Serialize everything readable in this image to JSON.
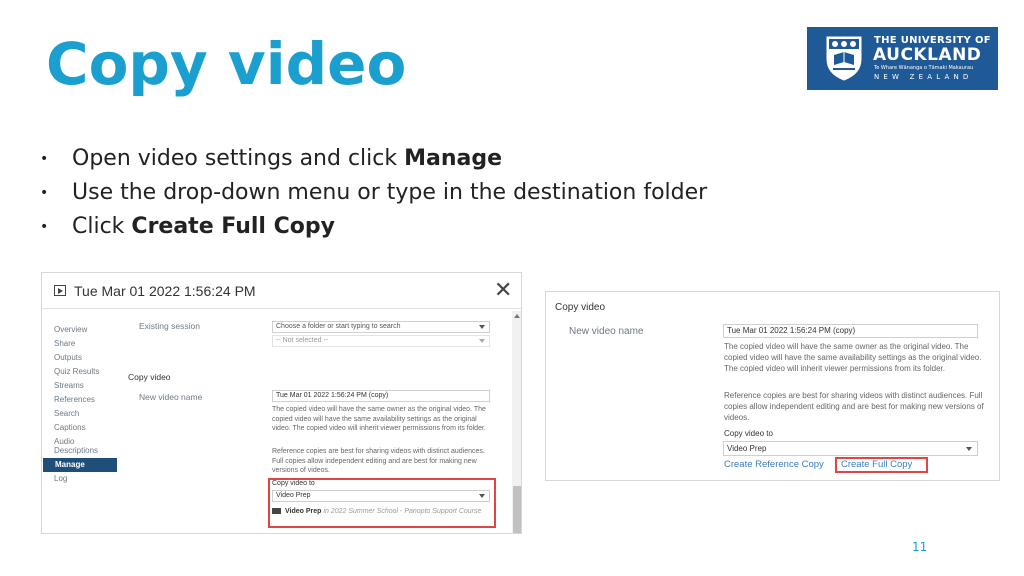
{
  "slide": {
    "title": "Copy video",
    "page_number": "11",
    "accent_color": "#1a9fcf"
  },
  "logo": {
    "line1": "THE UNIVERSITY OF",
    "line2": "AUCKLAND",
    "line3": "Te Whare Wānanga o Tāmaki Makaurau",
    "line4": "NEW ZEALAND",
    "bg_color": "#1f5a96"
  },
  "bullets": [
    {
      "text": "Open video settings and click ",
      "bold": "Manage"
    },
    {
      "text": "Use the drop-down menu or type in the destination folder",
      "bold": ""
    },
    {
      "text": "Click ",
      "bold": "Create Full Copy"
    }
  ],
  "bullet_glyph": "•",
  "settings_dialog": {
    "title": "Tue Mar 01 2022 1:56:24 PM",
    "close_glyph": "✕",
    "nav": [
      "Overview",
      "Share",
      "Outputs",
      "Quiz Results",
      "Streams",
      "References",
      "Search",
      "Captions",
      "Audio Descriptions",
      "Manage",
      "Log"
    ],
    "active_nav": "Manage",
    "existing_session_label": "Existing session",
    "folder_placeholder": "Choose a folder or start typing to search",
    "not_selected": "-- Not selected --",
    "copy_video_section": "Copy video",
    "new_video_name_label": "New video name",
    "new_video_name_value": "Tue Mar 01 2022 1:56:24 PM (copy)",
    "note_same_owner": "The copied video will have the same owner as the original video. The copied video will have the same availability settings as the original video. The copied video will inherit viewer permissions from its folder.",
    "note_reference": "Reference copies are best for sharing videos with distinct audiences. Full copies allow independent editing and are best for making new versions of videos.",
    "copy_to_label": "Copy video to",
    "copy_to_value": "Video Prep",
    "folder_option_name": "Video Prep",
    "folder_option_path": "in 2022 Summer School - Panopto Support Course"
  },
  "copy_panel": {
    "section": "Copy video",
    "new_video_name_label": "New video name",
    "new_video_name_value": "Tue Mar 01 2022 1:56:24 PM (copy)",
    "note_same_owner": "The copied video will have the same owner as the original video. The copied video will have the same availability settings as the original video. The copied video will inherit viewer permissions from its folder.",
    "note_reference": "Reference copies are best for sharing videos with distinct audiences. Full copies allow independent editing and are best for making new versions of videos.",
    "copy_to_label": "Copy video to",
    "copy_to_value": "Video Prep",
    "create_reference_copy": "Create Reference Copy",
    "create_full_copy": "Create Full Copy",
    "highlight_color": "#e04545",
    "link_color": "#3a7fc0"
  }
}
